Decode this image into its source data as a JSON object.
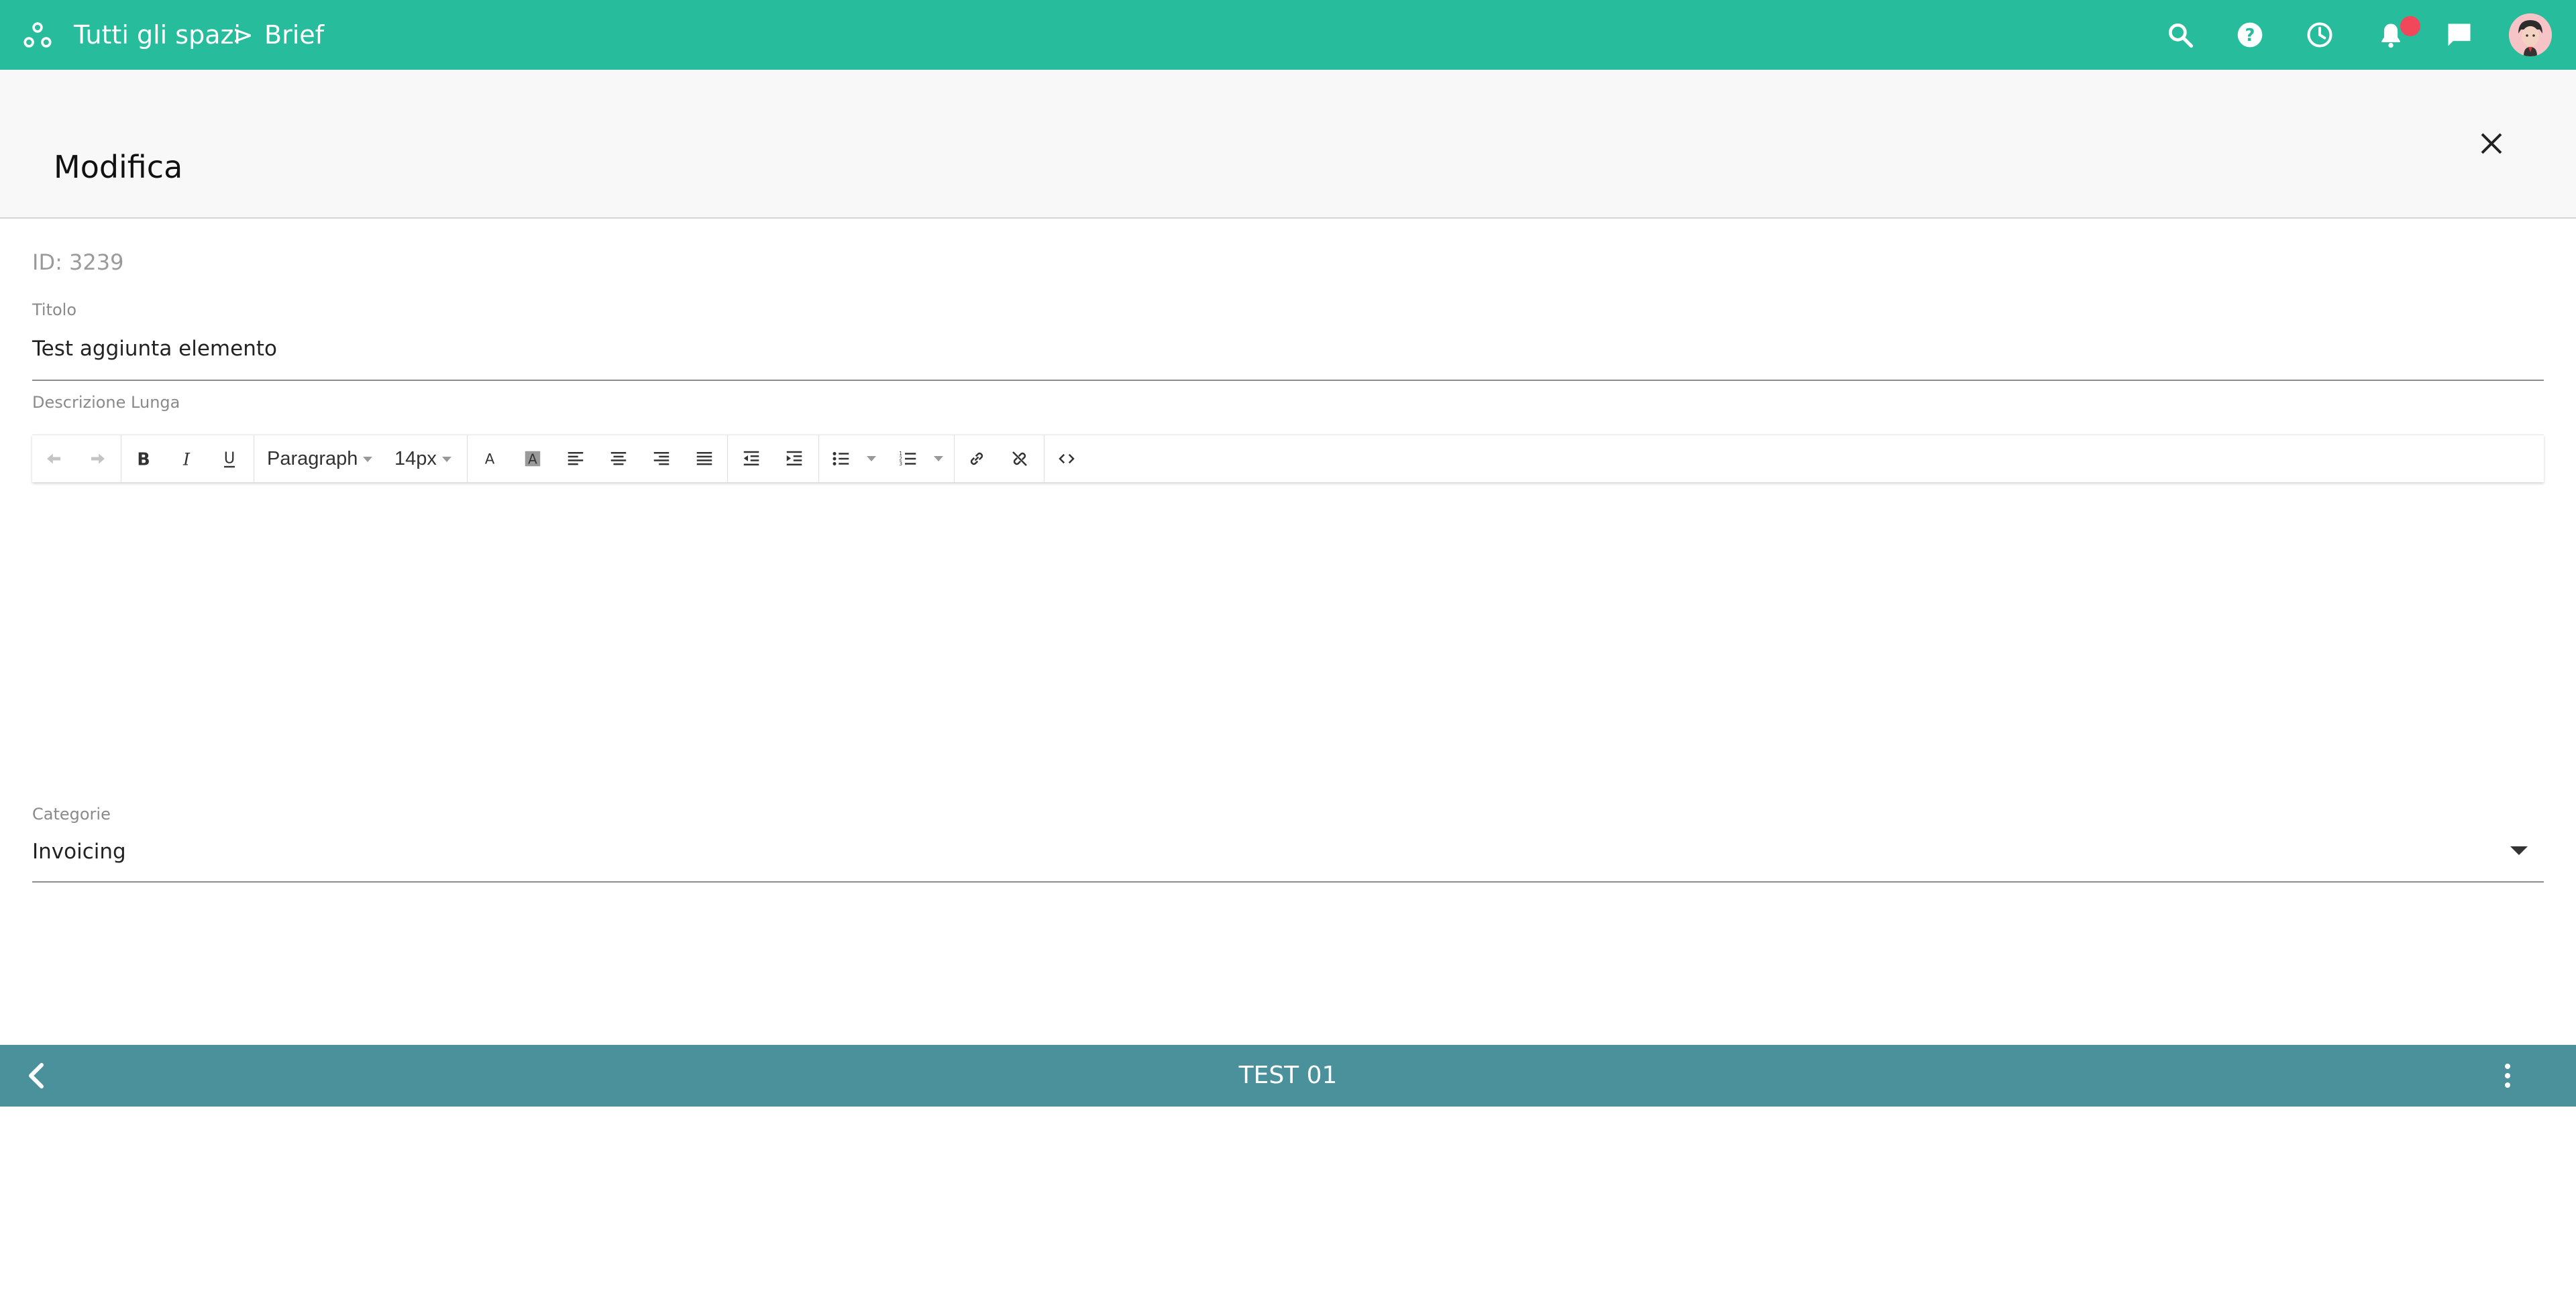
{
  "topbar": {
    "breadcrumb_root": "Tutti gli spazi",
    "breadcrumb_separator": ">",
    "breadcrumb_current": "Brief",
    "icons": [
      "logo-icon",
      "search-icon",
      "help-icon",
      "history-icon",
      "bell-icon",
      "chat-icon",
      "avatar"
    ],
    "accent_color": "#26bc9c",
    "notification_color": "#f2465a"
  },
  "dialog": {
    "title": "Modifica",
    "id_text": "ID: 3239",
    "fields": {
      "titolo_label": "Titolo",
      "titolo_value": "Test aggiunta elemento",
      "descrizione_label": "Descrizione Lunga",
      "categorie_label": "Categorie",
      "categorie_value": "Invoicing"
    },
    "toolbar": {
      "paragraph": "Paragraph",
      "font_size": "14px",
      "buttons": [
        "undo",
        "redo",
        "bold",
        "italic",
        "underline",
        "font-color",
        "background-color",
        "align-left",
        "align-center",
        "align-right",
        "align-justify",
        "outdent",
        "indent",
        "bullet-list",
        "numbered-list",
        "link",
        "unlink",
        "source-code"
      ]
    }
  },
  "bottombar": {
    "title": "TEST 01",
    "color": "#4a919c"
  }
}
